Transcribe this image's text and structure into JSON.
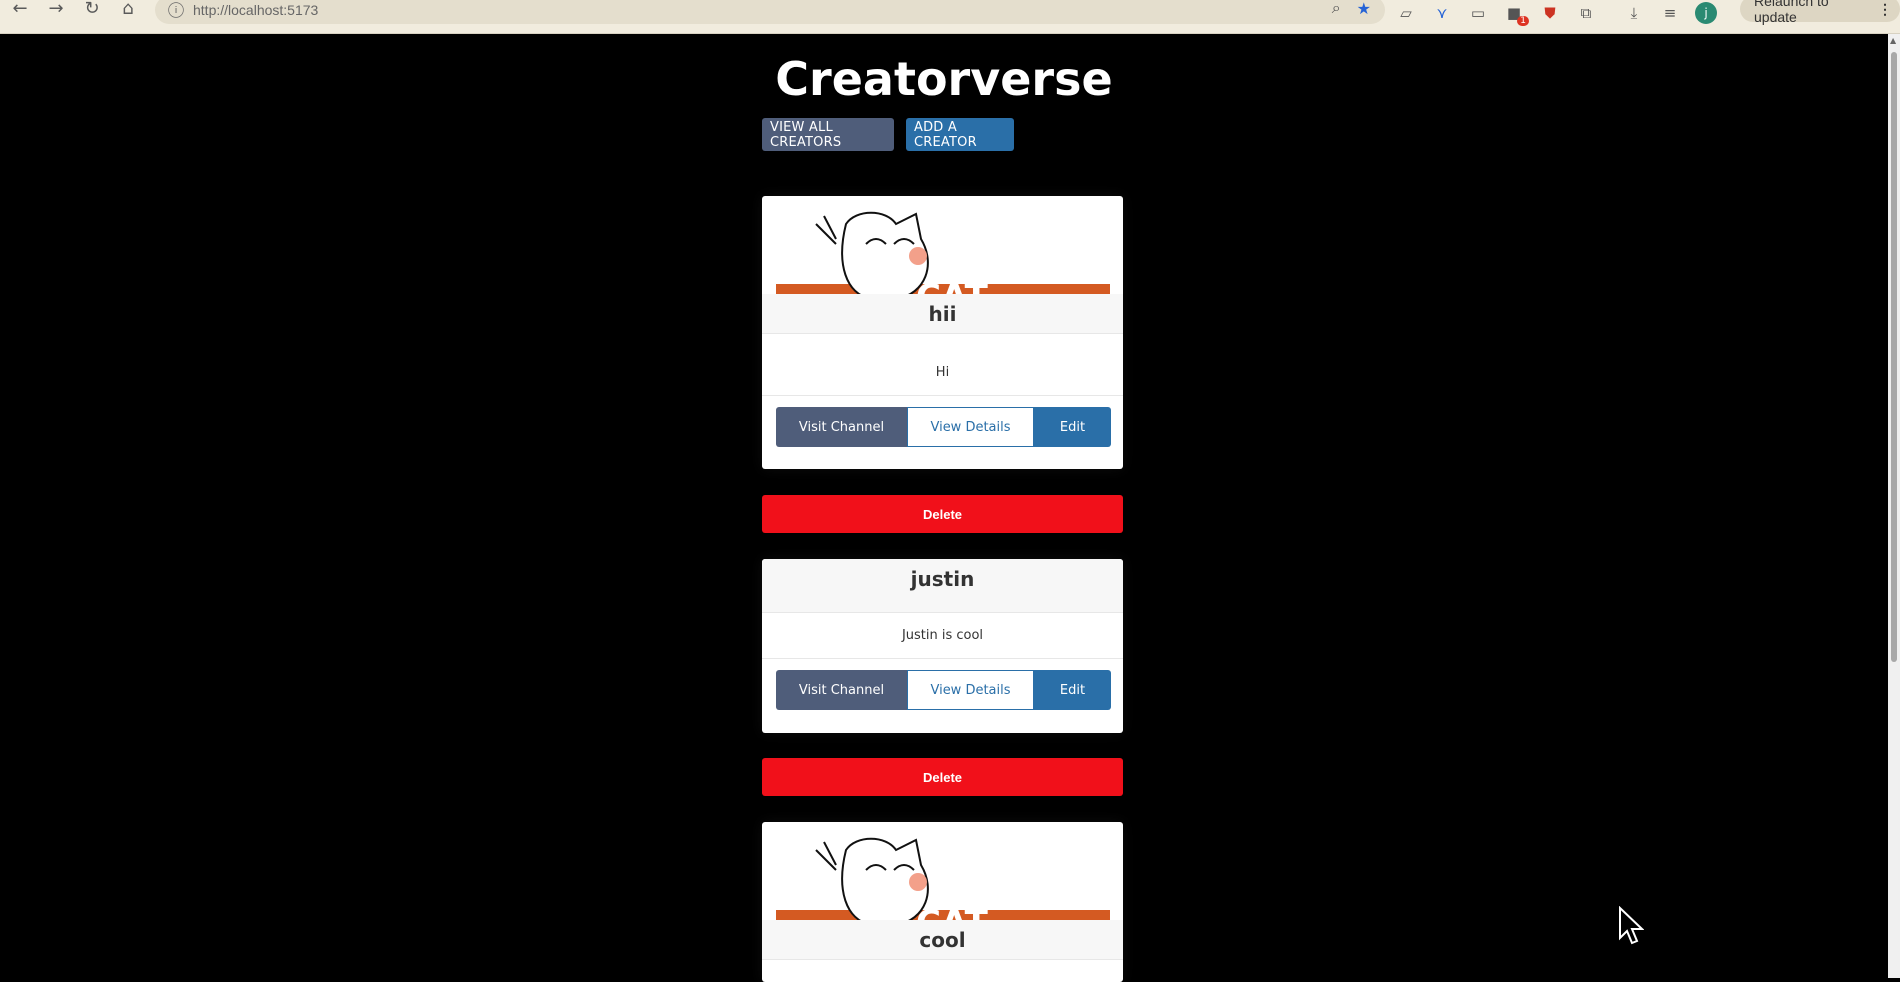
{
  "browser": {
    "url": "http://localhost:5173",
    "relaunch_label": "Relaunch to update",
    "avatar_letter": "j",
    "extension_badge": "1"
  },
  "page": {
    "title": "Creatorverse",
    "nav": {
      "view_all_label": "VIEW ALL CREATORS",
      "add_label": "ADD A CREATOR"
    }
  },
  "creators": [
    {
      "name": "hii",
      "description": "Hi",
      "has_image": true
    },
    {
      "name": "justin",
      "description": "Justin is cool",
      "has_image": false
    },
    {
      "name": "cool",
      "description": "",
      "has_image": true
    }
  ],
  "card_actions": {
    "visit_label": "Visit Channel",
    "details_label": "View Details",
    "edit_label": "Edit",
    "delete_label": "Delete"
  },
  "colors": {
    "background": "#000000",
    "primary": "#2a6fa8",
    "secondary": "#4f5d7a",
    "danger": "#f1101a"
  }
}
